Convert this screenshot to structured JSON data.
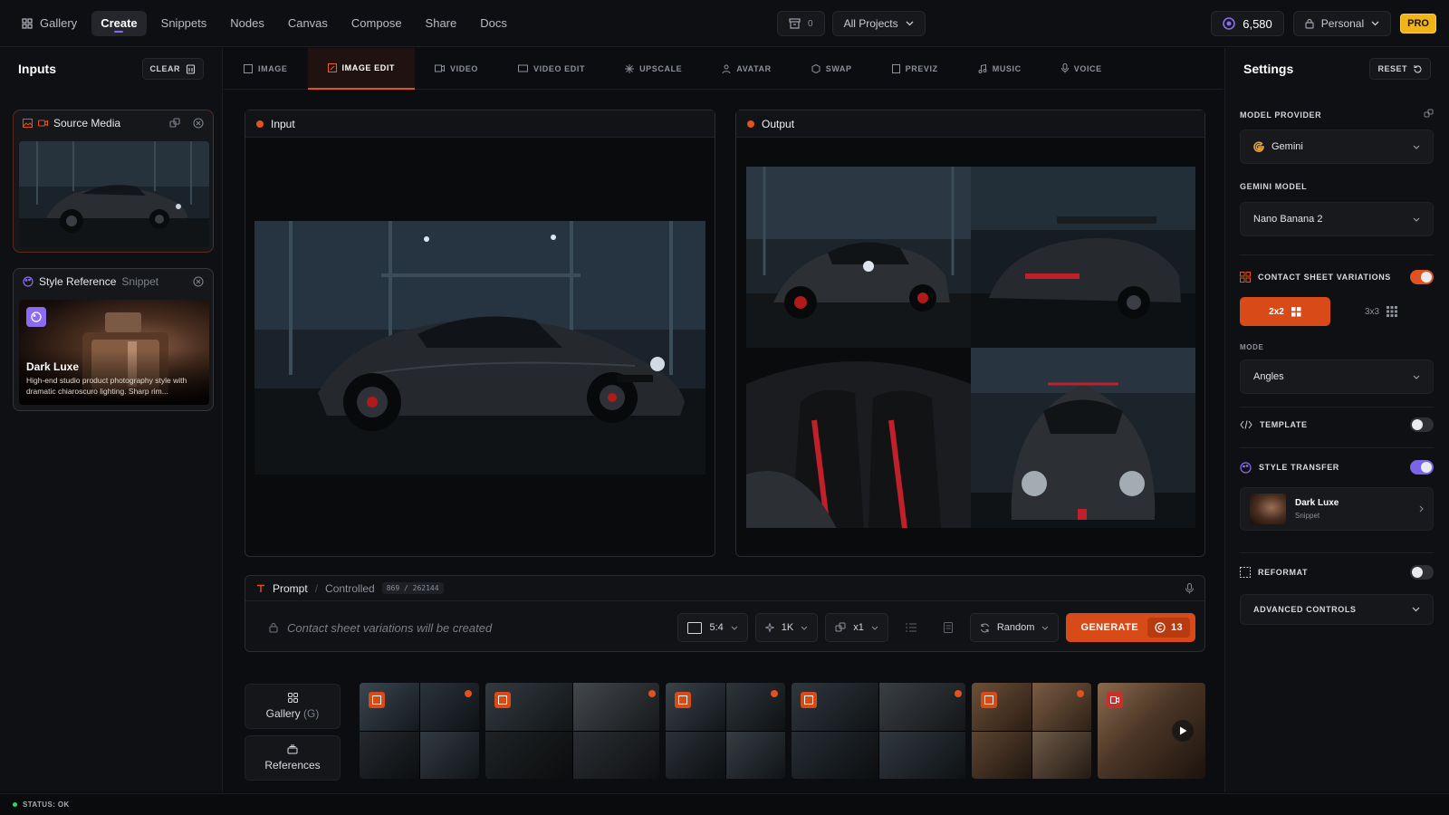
{
  "topnav": {
    "items": [
      {
        "label": "Gallery"
      },
      {
        "label": "Create"
      },
      {
        "label": "Snippets"
      },
      {
        "label": "Nodes"
      },
      {
        "label": "Canvas"
      },
      {
        "label": "Compose"
      },
      {
        "label": "Share"
      },
      {
        "label": "Docs"
      }
    ],
    "cart_count": "0",
    "project_selector": "All Projects",
    "credits": "6,580",
    "workspace": "Personal",
    "plan_badge": "PRO"
  },
  "inputs_panel": {
    "title": "Inputs",
    "clear_label": "CLEAR",
    "source_card": {
      "title": "Source Media"
    },
    "style_card": {
      "title": "Style Reference",
      "subtitle": "Snippet",
      "name": "Dark Luxe",
      "description": "High-end studio product photography style with dramatic chiaroscuro lighting. Sharp rim..."
    }
  },
  "tabs": [
    {
      "label": "IMAGE"
    },
    {
      "label": "IMAGE EDIT"
    },
    {
      "label": "VIDEO"
    },
    {
      "label": "VIDEO EDIT"
    },
    {
      "label": "UPSCALE"
    },
    {
      "label": "AVATAR"
    },
    {
      "label": "SWAP"
    },
    {
      "label": "PREVIZ"
    },
    {
      "label": "MUSIC"
    },
    {
      "label": "VOICE"
    }
  ],
  "input_frame": {
    "title": "Input"
  },
  "output_frame": {
    "title": "Output"
  },
  "prompt": {
    "title": "Prompt",
    "mode": "Controlled",
    "counter": "869 / 262144",
    "placeholder": "Contact sheet variations will be created",
    "aspect": "5:4",
    "resolution": "1K",
    "count": "x1",
    "seed": "Random",
    "generate_label": "GENERATE",
    "generate_cost": "13"
  },
  "gallery_strip": {
    "gallery_label": "Gallery",
    "gallery_shortcut": "(G)",
    "references_label": "References"
  },
  "settings_panel": {
    "title": "Settings",
    "reset_label": "RESET",
    "model_provider_label": "MODEL PROVIDER",
    "model_provider_value": "Gemini",
    "gemini_model_label": "GEMINI MODEL",
    "gemini_model_value": "Nano Banana 2",
    "contact_sheet_label": "CONTACT SHEET VARIATIONS",
    "grid_2x2": "2x2",
    "grid_3x3": "3x3",
    "mode_label": "MODE",
    "mode_value": "Angles",
    "template_label": "TEMPLATE",
    "style_transfer_label": "STYLE TRANSFER",
    "style_name": "Dark Luxe",
    "style_type": "Snippet",
    "reformat_label": "REFORMAT",
    "advanced_label": "ADVANCED CONTROLS"
  },
  "status": {
    "text": "STATUS: OK"
  },
  "colors": {
    "accent": "#e0521f",
    "purple": "#7c64e8",
    "gold": "#f0b419",
    "status_ok": "#2fd46a"
  }
}
